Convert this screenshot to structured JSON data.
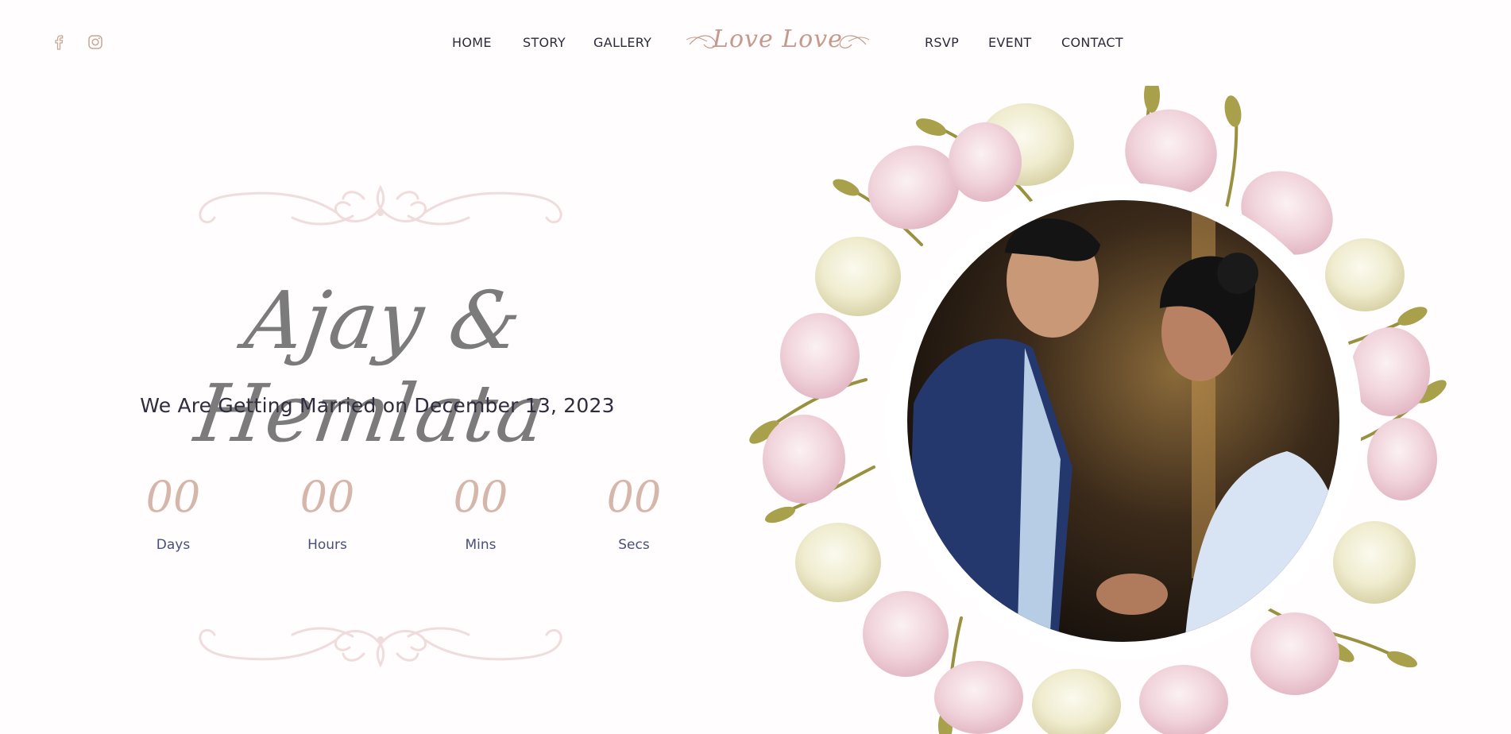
{
  "header": {
    "social": [
      {
        "icon": "facebook-icon",
        "label": "f"
      },
      {
        "icon": "instagram-icon",
        "label": ""
      }
    ],
    "nav_left": [
      "HOME",
      "STORY",
      "GALLERY"
    ],
    "logo_text": "Love Love",
    "nav_right": [
      "RSVP",
      "EVENT",
      "CONTACT"
    ]
  },
  "hero": {
    "names": "Ajay & Hemlata",
    "subtitle": "We Are Getting Married on December 13, 2023",
    "countdown": [
      {
        "value": "00",
        "label": "Days"
      },
      {
        "value": "00",
        "label": "Hours"
      },
      {
        "value": "00",
        "label": "Mins"
      },
      {
        "value": "00",
        "label": "Secs"
      }
    ]
  },
  "colors": {
    "accent": "#d6b6ab",
    "ornament": "#f0dcdc",
    "text": "#2b2b3a",
    "label": "#46507a"
  }
}
